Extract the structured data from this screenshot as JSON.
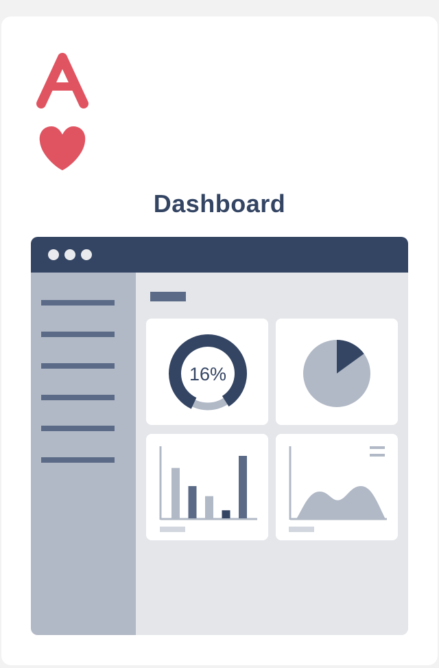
{
  "card": {
    "suit": "hearts",
    "rank": "A"
  },
  "title": "Dashboard",
  "window": {
    "titlebar_dots": 3,
    "sidebar_items": 6
  },
  "widgets": {
    "donut_label": "16%",
    "donut_fraction": 0.16,
    "pie_fraction": 0.15
  },
  "chart_data": [
    {
      "type": "bar",
      "values": [
        5,
        3.2,
        2.2,
        0.8,
        6.2
      ]
    }
  ],
  "colors": {
    "accent_red": "#e05461",
    "navy": "#344563",
    "slate": "#5b6b87",
    "gray": "#b1b9c6",
    "light_gray": "#d2d7df",
    "bg": "#e4e6ea"
  }
}
